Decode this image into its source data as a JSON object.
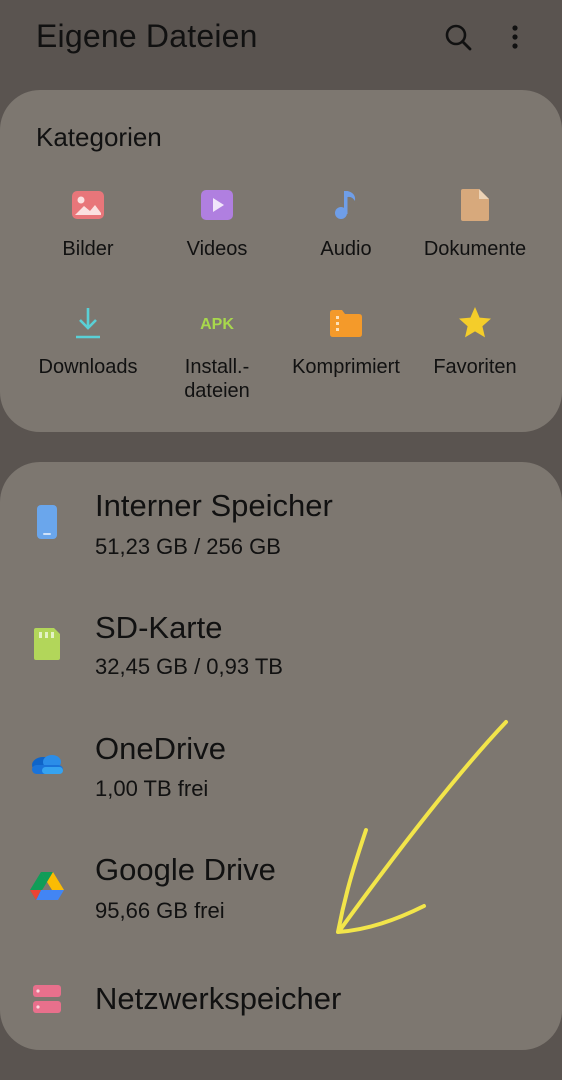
{
  "header": {
    "title": "Eigene Dateien",
    "search_icon": "search-icon",
    "more_icon": "more-vert-icon"
  },
  "categories": {
    "title": "Kategorien",
    "items": [
      {
        "label": "Bilder",
        "icon": "image-icon",
        "color": "#e8767a"
      },
      {
        "label": "Videos",
        "icon": "video-icon",
        "color": "#b07fe0"
      },
      {
        "label": "Audio",
        "icon": "music-note-icon",
        "color": "#6f9ee8"
      },
      {
        "label": "Dokumente",
        "icon": "document-icon",
        "color": "#d7a97c"
      },
      {
        "label": "Downloads",
        "icon": "download-icon",
        "color": "#5ad0d6"
      },
      {
        "label": "Install.-\ndateien",
        "icon": "apk-icon",
        "icon_text": "APK",
        "color": "#a8d84c"
      },
      {
        "label": "Komprimiert",
        "icon": "archive-folder-icon",
        "color": "#f49a2a"
      },
      {
        "label": "Favoriten",
        "icon": "star-icon",
        "color": "#f4cd2a"
      }
    ]
  },
  "storage": {
    "items": [
      {
        "name": "Interner Speicher",
        "detail": "51,23 GB / 256 GB",
        "icon": "phone-storage-icon",
        "color": "#6aa6ec"
      },
      {
        "name": "SD-Karte",
        "detail": "32,45 GB / 0,93 TB",
        "icon": "sd-card-icon",
        "color": "#b2d65a"
      },
      {
        "name": "OneDrive",
        "detail": "1,00 TB frei",
        "icon": "onedrive-icon",
        "color": "#1a73d9"
      },
      {
        "name": "Google Drive",
        "detail": "95,66 GB frei",
        "icon": "google-drive-icon",
        "color": "#34a853"
      },
      {
        "name": "Netzwerkspeicher",
        "detail": "",
        "icon": "network-storage-icon",
        "color": "#e8708c"
      }
    ]
  },
  "annotation": {
    "icon": "yellow-arrow-annotation",
    "color": "#f2e54a"
  }
}
